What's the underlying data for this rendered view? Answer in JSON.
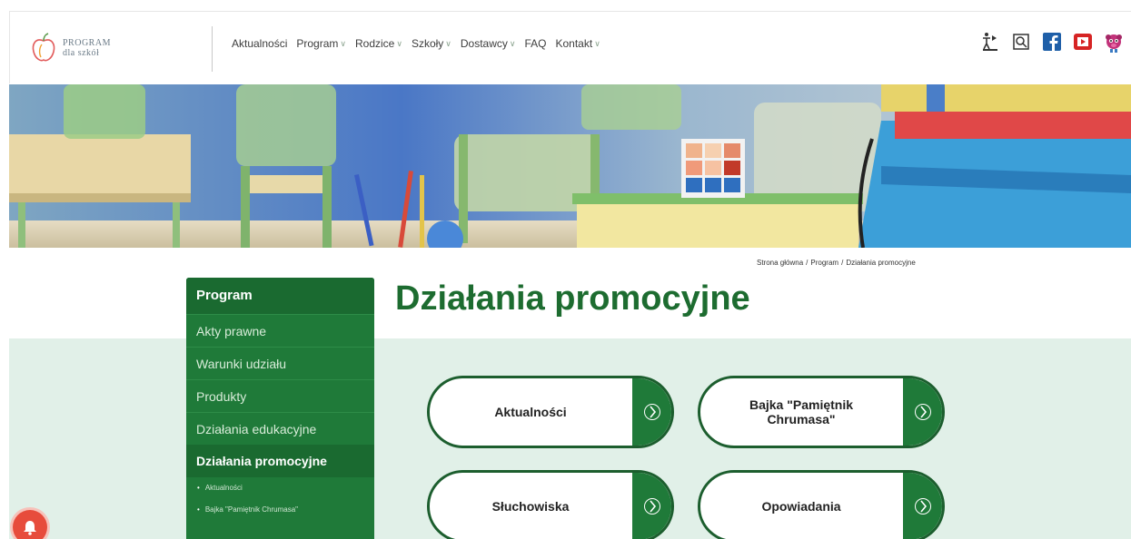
{
  "header": {
    "logo": {
      "line1": "PROGRAM",
      "line2": "dla szkół"
    },
    "nav": [
      {
        "label": "Aktualności",
        "has_dropdown": false
      },
      {
        "label": "Program",
        "has_dropdown": true
      },
      {
        "label": "Rodzice",
        "has_dropdown": true
      },
      {
        "label": "Szkoły",
        "has_dropdown": true
      },
      {
        "label": "Dostawcy",
        "has_dropdown": true
      },
      {
        "label": "FAQ",
        "has_dropdown": false
      },
      {
        "label": "Kontakt",
        "has_dropdown": true
      }
    ],
    "icons": [
      "accessibility-icon",
      "search-icon",
      "facebook-icon",
      "youtube-icon",
      "mascot-icon"
    ]
  },
  "breadcrumb": {
    "items": [
      "Strona główna",
      "Program",
      "Działania promocyjne"
    ],
    "separator": "/"
  },
  "sidebar": {
    "heading": "Program",
    "items": [
      {
        "label": "Akty prawne"
      },
      {
        "label": "Warunki udziału"
      },
      {
        "label": "Produkty"
      },
      {
        "label": "Działania edukacyjne"
      }
    ],
    "active": "Działania promocyjne",
    "subitems": [
      {
        "label": "Aktualności"
      },
      {
        "label": "Bajka \"Pamiętnik Chrumasa\""
      }
    ]
  },
  "main": {
    "title": "Działania promocyjne",
    "cards": [
      {
        "label": "Aktualności"
      },
      {
        "label": "Bajka \"Pamiętnik\nChrumasa\""
      },
      {
        "label": "Słuchowiska"
      },
      {
        "label": "Opowiadania"
      }
    ]
  },
  "colors": {
    "brand_green": "#1f7a39",
    "dark_green": "#1a6a30",
    "mint": "#e1f0e8",
    "notification": "#e74c3c"
  }
}
